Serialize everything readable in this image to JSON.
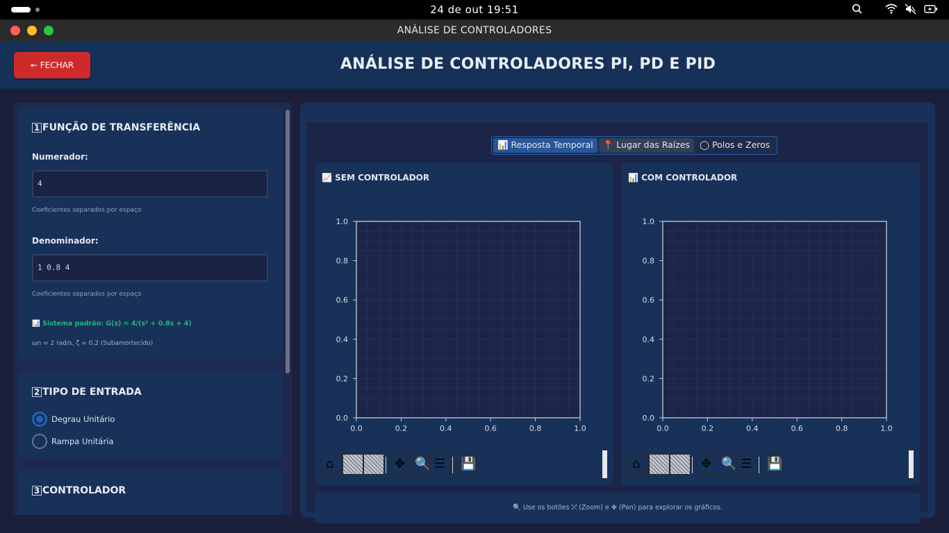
{
  "menubar": {
    "clock": "24 de out  19:51",
    "icons": [
      "search-icon",
      "wifi-icon",
      "mute-icon",
      "battery-icon"
    ]
  },
  "window": {
    "title": "ANÁLISE DE CONTROLADORES",
    "traffic": {
      "close": "#ff5f57",
      "minimize": "#febc2e",
      "zoom": "#28c840"
    }
  },
  "header": {
    "close_label": "← FECHAR",
    "title": "ANÁLISE DE CONTROLADORES PI, PD E PID"
  },
  "sections": {
    "tf": {
      "number": "1",
      "title": "FUNÇÃO DE TRANSFERÊNCIA",
      "numerator_label": "Numerador:",
      "numerator_value": "4",
      "numerator_hint": "Coeficientes separados por espaço",
      "denominator_label": "Denominador:",
      "denominator_value": "1 0.8 4",
      "denominator_hint": "Coeficientes separados por espaço",
      "default_system": "📊 Sistema padrão: G(s) = 4/(s² + 0.8s + 4)",
      "system_params": "ωn = 2 rad/s, ζ = 0.2 (Subamortecido)"
    },
    "input": {
      "number": "2",
      "title": "TIPO DE ENTRADA",
      "options": [
        {
          "label": "Degrau Unitário",
          "selected": true
        },
        {
          "label": "Rampa Unitária",
          "selected": false
        }
      ]
    },
    "controller": {
      "number": "3",
      "title": "CONTROLADOR"
    }
  },
  "tabs": [
    {
      "label": "📊 Resposta Temporal",
      "active": true
    },
    {
      "label": "📍 Lugar das Raízes",
      "active": false
    },
    {
      "label": "◯ Polos e Zeros",
      "active": false
    }
  ],
  "plots": {
    "left_title": "📈 SEM CONTROLADOR",
    "right_title": "📊 COM CONTROLADOR"
  },
  "chart_data": [
    {
      "type": "line",
      "title": "SEM CONTROLADOR",
      "series": [],
      "xlim": [
        0.0,
        1.0
      ],
      "ylim": [
        0.0,
        1.0
      ],
      "xticks": [
        "0.0",
        "0.2",
        "0.4",
        "0.6",
        "0.8",
        "1.0"
      ],
      "yticks": [
        "0.0",
        "0.2",
        "0.4",
        "0.6",
        "0.8",
        "1.0"
      ],
      "grid": true
    },
    {
      "type": "line",
      "title": "COM CONTROLADOR",
      "series": [],
      "xlim": [
        0.0,
        1.0
      ],
      "ylim": [
        0.0,
        1.0
      ],
      "xticks": [
        "0.0",
        "0.2",
        "0.4",
        "0.6",
        "0.8",
        "1.0"
      ],
      "yticks": [
        "0.0",
        "0.2",
        "0.4",
        "0.6",
        "0.8",
        "1.0"
      ],
      "grid": true
    }
  ],
  "toolbar_icons": [
    "home-icon",
    "back-icon",
    "forward-icon",
    "pan-icon",
    "zoom-icon",
    "configure-icon",
    "save-icon"
  ],
  "info": "🔍 Use os botões ⤱ (Zoom) e ✥ (Pan) para explorar os gráficos."
}
